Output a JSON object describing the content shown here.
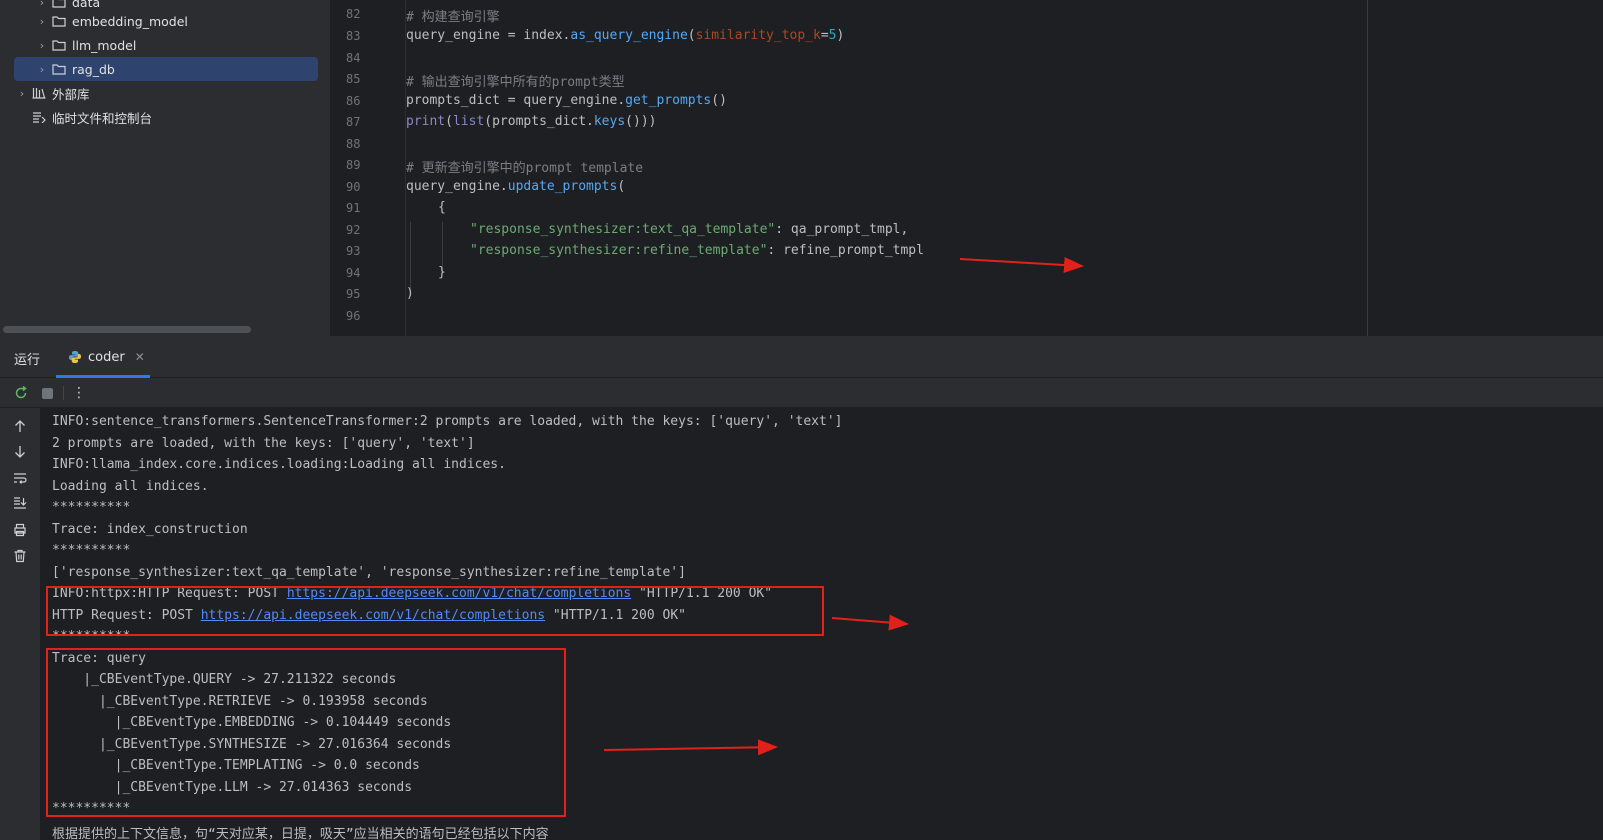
{
  "project_tree": {
    "items": [
      {
        "label": "data",
        "type": "folder"
      },
      {
        "label": "embedding_model",
        "type": "folder"
      },
      {
        "label": "llm_model",
        "type": "folder"
      },
      {
        "label": "rag_db",
        "type": "folder",
        "selected": true
      },
      {
        "label": "外部库",
        "type": "library"
      },
      {
        "label": "临时文件和控制台",
        "type": "scratches"
      }
    ]
  },
  "editor": {
    "line_numbers": [
      "82",
      "83",
      "84",
      "85",
      "86",
      "87",
      "88",
      "89",
      "90",
      "91",
      "92",
      "93",
      "94",
      "95",
      "96"
    ],
    "lines": {
      "l82": "# 构建查询引擎",
      "l83_a": "query_engine = index.",
      "l83_b": "as_query_engine",
      "l83_c": "(",
      "l83_d": "similarity_top_k",
      "l83_e": "=",
      "l83_f": "5",
      "l83_g": ")",
      "l85": "# 输出查询引擎中所有的prompt类型",
      "l86_a": "prompts_dict = query_engine.",
      "l86_b": "get_prompts",
      "l86_c": "()",
      "l87_a": "print",
      "l87_b": "(",
      "l87_c": "list",
      "l87_d": "(prompts_dict.",
      "l87_e": "keys",
      "l87_f": "()))",
      "l89": "# 更新查询引擎中的prompt template",
      "l90_a": "query_engine.",
      "l90_b": "update_prompts",
      "l90_c": "(",
      "l91": "{",
      "l92_a": "\"response_synthesizer:text_qa_template\"",
      "l92_b": ": qa_prompt_tmpl,",
      "l93_a": "\"response_synthesizer:refine_template\"",
      "l93_b": ": refine_prompt_tmpl",
      "l94": "}",
      "l95": ")"
    }
  },
  "run_window": {
    "title": "运行",
    "tab_label": "coder",
    "console_lines": [
      "INFO:sentence_transformers.SentenceTransformer:2 prompts are loaded, with the keys: ['query', 'text']",
      "2 prompts are loaded, with the keys: ['query', 'text']",
      "INFO:llama_index.core.indices.loading:Loading all indices.",
      "Loading all indices.",
      "**********",
      "Trace: index_construction",
      "**********",
      "['response_synthesizer:text_qa_template', 'response_synthesizer:refine_template']",
      "",
      "",
      "**********",
      "Trace: query",
      "    |_CBEventType.QUERY -> 27.211322 seconds",
      "      |_CBEventType.RETRIEVE -> 0.193958 seconds",
      "        |_CBEventType.EMBEDDING -> 0.104449 seconds",
      "      |_CBEventType.SYNTHESIZE -> 27.016364 seconds",
      "        |_CBEventType.TEMPLATING -> 0.0 seconds",
      "        |_CBEventType.LLM -> 27.014363 seconds",
      "**********",
      "根据提供的上下文信息，句“天对应某，日提，吸天”应当相关的语句已经包括以下内容"
    ],
    "http_line_1": {
      "prefix": "INFO:httpx:HTTP Request: POST ",
      "url": "https://api.deepseek.com/v1/chat/completions",
      "suffix": " \"HTTP/1.1 200 OK\""
    },
    "http_line_2": {
      "prefix": "HTTP Request: POST ",
      "url": "https://api.deepseek.com/v1/chat/completions",
      "suffix": " \"HTTP/1.1 200 OK\""
    }
  },
  "colors": {
    "background": "#1e1f22",
    "panel": "#2b2d30",
    "selection": "#2e436e",
    "annotation_red": "#e3211b",
    "link": "#548af7"
  }
}
